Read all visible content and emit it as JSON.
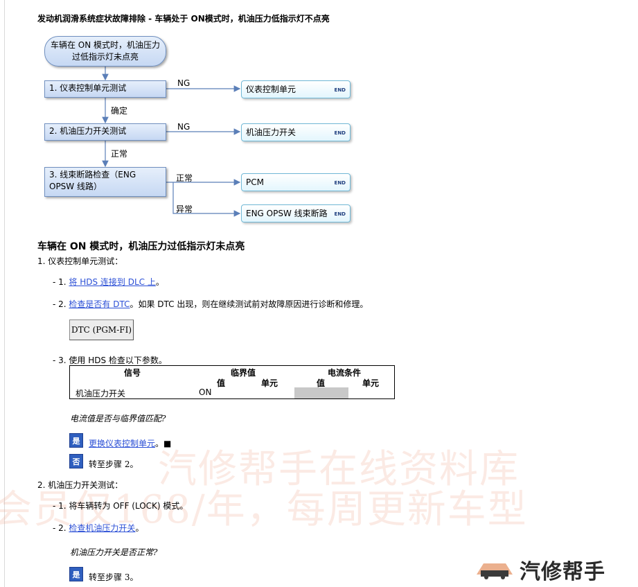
{
  "title": "发动机润滑系统症状故障排除 - 车辆处于 ON模式时，机油压力低指示灯不点亮",
  "flowchart": {
    "start": "车辆在 ON 模式时，机油压力过低指示灯未点亮",
    "steps": [
      {
        "label": "1.  仪表控制单元测试"
      },
      {
        "label": "2.  机油压力开关测试"
      },
      {
        "label": "3.  线束断路检查（ENG OPSW 线路）"
      }
    ],
    "edges": {
      "ng1": "NG",
      "confirm": "确定",
      "ng2": "NG",
      "normal1": "正常",
      "normal2": "正常",
      "abnormal": "异常"
    },
    "ends": [
      {
        "label": "仪表控制单元",
        "tag": "END"
      },
      {
        "label": "机油压力开关",
        "tag": "END"
      },
      {
        "label": "PCM",
        "tag": "END"
      },
      {
        "label": "ENG OPSW 线束断路",
        "tag": "END"
      }
    ]
  },
  "section": {
    "title": "车辆在 ON 模式时，机油压力过低指示灯未点亮",
    "step1": {
      "title": "1.  仪表控制单元测试：",
      "s1_prefix": "- 1. ",
      "s1_link": "将 HDS 连接到 DLC 上",
      "s1_suffix": "。",
      "s2_prefix": "- 2. ",
      "s2_link": "检查是否有 DTC",
      "s2_suffix": "。如果 DTC 出现，则在继续测试前对故障原因进行诊断和修理。",
      "dtc_button": "DTC (PGM-FI)",
      "s3": "- 3. 使用 HDS 检查以下参数。",
      "table": {
        "h_signal": "信号",
        "h_threshold": "临界值",
        "h_current": "电流条件",
        "sub_value1": "值",
        "sub_unit1": "单元",
        "sub_value2": "值",
        "sub_unit2": "单元",
        "row_signal": "机油压力开关",
        "row_value": "ON"
      },
      "question": "电流值是否与临界值匹配?",
      "yes_badge": "是",
      "yes_link": "更换仪表控制单元",
      "yes_suffix": "。■",
      "no_badge": "否",
      "no_text": "转至步骤 2。"
    },
    "step2": {
      "title": "2.  机油压力开关测试：",
      "s1": "- 1. 将车辆转为 OFF (LOCK) 模式。",
      "s2_prefix": "- 2. ",
      "s2_link": "检查机油压力开关",
      "s2_suffix": "。",
      "question": "机油压力开关是否正常?",
      "yes_badge": "是",
      "yes_text": "转至步骤 3。"
    }
  },
  "watermark": {
    "line1": "汽修帮手在线资料库",
    "line2": "会员仅168/年，每周更新车型"
  },
  "brand": {
    "name": "汽修帮手"
  },
  "colors": {
    "link": "#2b4fd6",
    "badge": "#2f5fbf",
    "box_fill": "#c6d8f3",
    "end_border": "#70b8d6",
    "arrow": "#5b7fb8"
  }
}
